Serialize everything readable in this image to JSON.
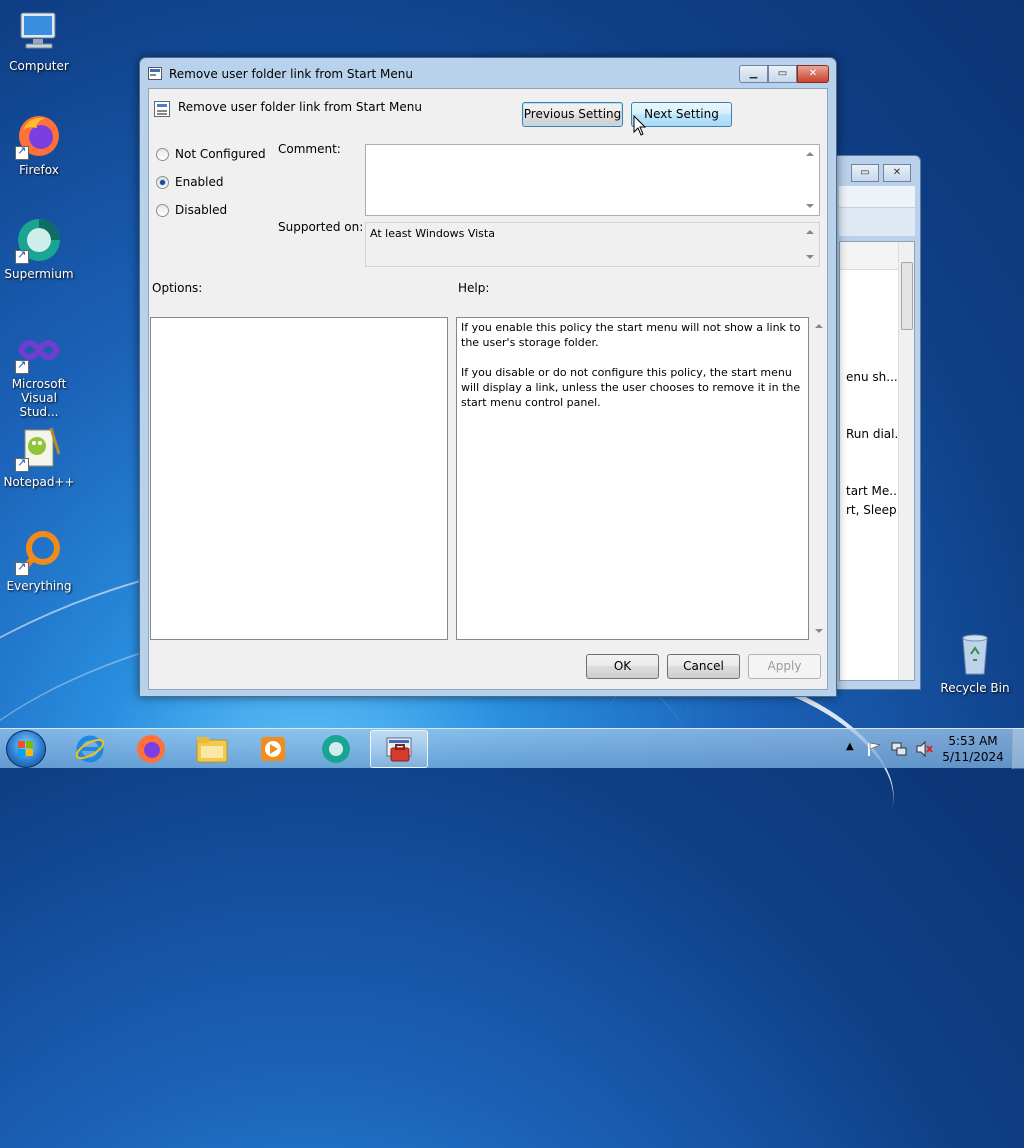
{
  "desktop": {
    "icons": [
      {
        "label": "Computer",
        "icon": "computer-icon"
      },
      {
        "label": "Firefox",
        "icon": "firefox-icon"
      },
      {
        "label": "Supermium",
        "icon": "supermium-icon"
      },
      {
        "label": "Microsoft Visual Stud...",
        "icon": "visual-studio-icon"
      },
      {
        "label": "Notepad++",
        "icon": "notepadpp-icon"
      },
      {
        "label": "Everything",
        "icon": "everything-icon"
      },
      {
        "label": "Recycle Bin",
        "icon": "recycle-bin-icon"
      }
    ]
  },
  "background_window": {
    "visible_snippets": [
      "enu sh...",
      "Run dial...",
      "tart Me...",
      "rt, Sleep..."
    ]
  },
  "dialog": {
    "title": "Remove user folder link from Start Menu",
    "header_title": "Remove user folder link from Start Menu",
    "previous_setting": "Previous Setting",
    "next_setting": "Next Setting",
    "radio_options": [
      "Not Configured",
      "Enabled",
      "Disabled"
    ],
    "selected_option": "Enabled",
    "comment_label": "Comment:",
    "comment_value": "",
    "supported_on_label": "Supported on:",
    "supported_on_value": "At least Windows Vista",
    "options_label": "Options:",
    "help_label": "Help:",
    "help_text": "If you enable this policy the start menu will not show a link to the user's storage folder.\n\nIf you disable or do not configure this policy, the start menu will display a link, unless the user chooses to remove it in the start menu control panel.",
    "ok_label": "OK",
    "cancel_label": "Cancel",
    "apply_label": "Apply"
  },
  "taskbar": {
    "pinned": [
      "internet-explorer-icon",
      "firefox-icon",
      "file-explorer-icon",
      "media-player-icon",
      "supermium-icon",
      "group-policy-editor-icon"
    ],
    "active_item": "group-policy-editor-icon",
    "time": "5:53 AM",
    "date": "5/11/2024"
  },
  "colors": {
    "dialog_frame": "#b8d2ec",
    "client_bg": "#f0f0f0",
    "hot_button": "#bee6fd",
    "desktop_blue": "#1b62b8"
  }
}
